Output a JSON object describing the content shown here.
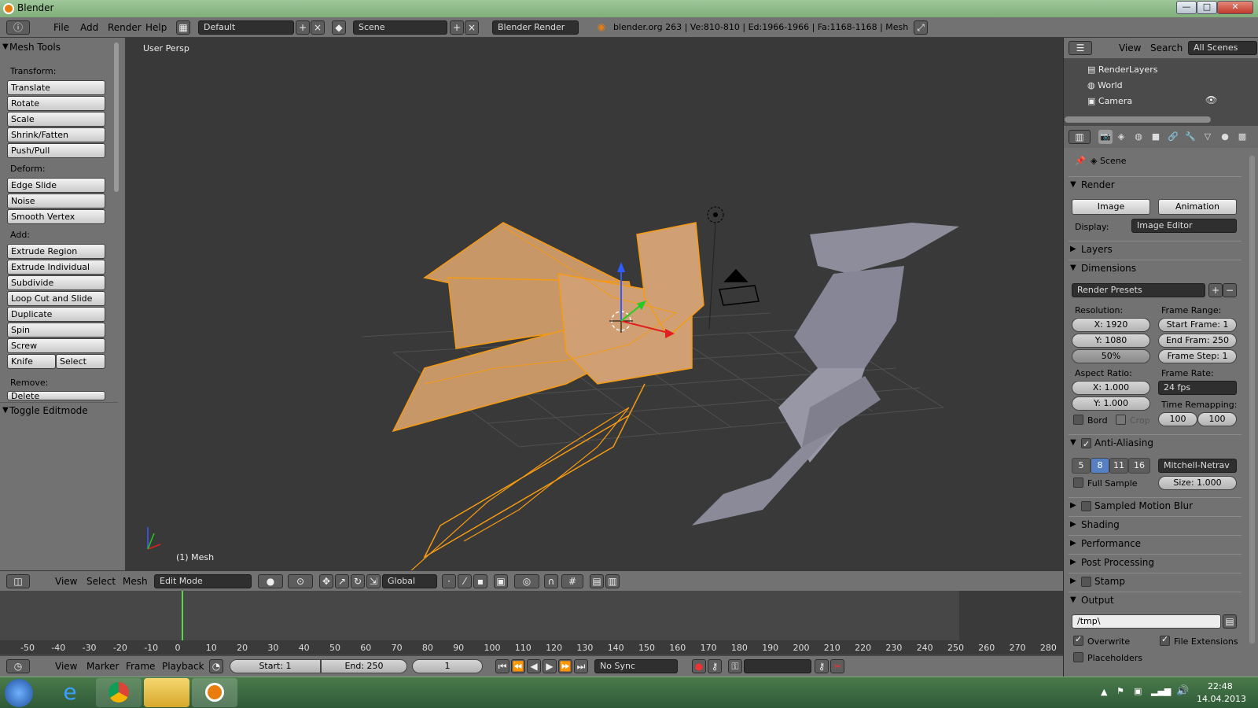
{
  "window": {
    "title": "Blender",
    "minimize": "—",
    "maximize": "□",
    "close": "✕"
  },
  "topbar": {
    "menus": [
      "File",
      "Add",
      "Render",
      "Help"
    ],
    "layout": "Default",
    "scene": "Scene",
    "engine": "Blender Render",
    "stats": "blender.org 263 | Ve:810-810 | Ed:1966-1966 | Fa:1168-1168 | Mesh"
  },
  "toolshelf": {
    "title": "Mesh Tools",
    "groups": [
      {
        "label": "Transform:",
        "tools": [
          "Translate",
          "Rotate",
          "Scale",
          "Shrink/Fatten",
          "Push/Pull"
        ]
      },
      {
        "label": "Deform:",
        "tools": [
          "Edge Slide",
          "Noise",
          "Smooth Vertex"
        ]
      },
      {
        "label": "Add:",
        "tools": [
          "Extrude Region",
          "Extrude Individual",
          "Subdivide",
          "Loop Cut and Slide",
          "Duplicate",
          "Spin",
          "Screw"
        ]
      }
    ],
    "knife": "Knife",
    "select": "Select",
    "remove_label": "Remove:",
    "delete": "Delete",
    "toggle_editmode": "Toggle Editmode"
  },
  "viewport": {
    "view_label": "User Persp",
    "object_label": "(1) Mesh"
  },
  "view3d_header": {
    "menus": [
      "View",
      "Select",
      "Mesh"
    ],
    "mode": "Edit Mode",
    "orientation": "Global"
  },
  "timeline": {
    "ticks": [
      "-50",
      "-40",
      "-30",
      "-20",
      "-10",
      "0",
      "10",
      "20",
      "30",
      "40",
      "50",
      "60",
      "70",
      "80",
      "90",
      "100",
      "110",
      "120",
      "130",
      "140",
      "150",
      "160",
      "170",
      "180",
      "190",
      "200",
      "210",
      "220",
      "230",
      "240",
      "250",
      "260",
      "270",
      "280"
    ],
    "menus": [
      "View",
      "Marker",
      "Frame",
      "Playback"
    ],
    "start": "Start: 1",
    "end": "End: 250",
    "current": "1",
    "sync": "No Sync"
  },
  "outliner": {
    "menus": [
      "View",
      "Search"
    ],
    "filter": "All Scenes",
    "rows": [
      "RenderLayers",
      "World",
      "Camera"
    ]
  },
  "properties": {
    "scene": "Scene",
    "render_section": "Render",
    "image_btn": "Image",
    "animation_btn": "Animation",
    "display_label": "Display:",
    "display_value": "Image Editor",
    "layers": "Layers",
    "dimensions": "Dimensions",
    "render_presets": "Render Presets",
    "resolution_label": "Resolution:",
    "res_x": "X: 1920",
    "res_y": "Y: 1080",
    "res_pct": "50%",
    "frame_range_label": "Frame Range:",
    "start_frame": "Start Frame: 1",
    "end_frame": "End Fram: 250",
    "frame_step": "Frame Step: 1",
    "aspect_label": "Aspect Ratio:",
    "aspect_x": "X: 1.000",
    "aspect_y": "Y: 1.000",
    "frame_rate_label": "Frame Rate:",
    "frame_rate": "24 fps",
    "time_remap_label": "Time Remapping:",
    "remap_old": "100",
    "remap_new": "100",
    "bord": "Bord",
    "crop": "Crop",
    "anti_aliasing": "Anti-Aliasing",
    "aa_samples": [
      "5",
      "8",
      "11",
      "16"
    ],
    "aa_filter": "Mitchell-Netrav",
    "full_sample": "Full Sample",
    "size": "Size: 1.000",
    "sampled_motion_blur": "Sampled Motion Blur",
    "shading": "Shading",
    "performance": "Performance",
    "post_processing": "Post Processing",
    "stamp": "Stamp",
    "output": "Output",
    "output_path": "/tmp\\",
    "overwrite": "Overwrite",
    "file_extensions": "File Extensions",
    "placeholders": "Placeholders"
  },
  "taskbar": {
    "time": "22:48",
    "date": "14.04.2013"
  }
}
